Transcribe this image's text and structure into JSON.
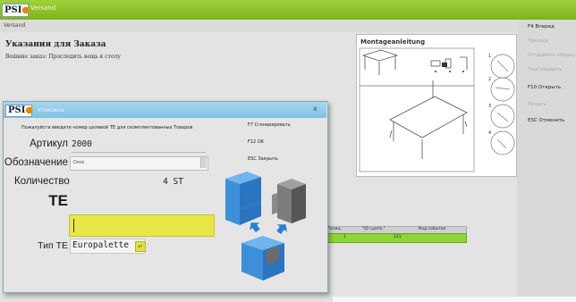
{
  "colors": {
    "accent_green": "#8bc12a",
    "dialog_title_blue": "#8ccbe9",
    "te_input_yellow": "#e9e648",
    "cube_blue": "#3d8fd8",
    "cube_gray": "#7c7c7c"
  },
  "background_window": {
    "logo_text": "PSI",
    "window_title": "Versand",
    "breadcrumb": "Versand",
    "heading": "Указания для Заказа",
    "note": "Вешние заказ: Проследить вещь к столу",
    "side_menu": [
      {
        "label": "F4 Вперед",
        "enabled": true
      },
      {
        "label": "Предыд",
        "enabled": false
      },
      {
        "label": "Отправить сборку",
        "enabled": false
      },
      {
        "label": "Подтвердить",
        "enabled": false
      },
      {
        "label": "F10 Открыть",
        "enabled": true
      },
      {
        "label": "Печать",
        "enabled": false
      },
      {
        "label": "ESC Отменить",
        "enabled": true
      }
    ],
    "instructions_panel": {
      "title": "Montageanleitung",
      "step_numbers": [
        "1",
        "2",
        "3",
        "4"
      ]
    },
    "grid": {
      "headers": [
        "Позиц.",
        "\"ID сцепл.\"",
        "Код события"
      ],
      "row": [
        "1",
        "121",
        ""
      ]
    }
  },
  "dialog": {
    "logo_text": "PSI",
    "window_title": "Упаковка",
    "close_glyph": "x",
    "prompt": "Пожалуйста введите номер целевой ТЕ для скомплектованных Товаров",
    "fields": {
      "article_label": "Артикул",
      "article_value": "2000",
      "description_label": "Обозначение",
      "description_value": "Desk",
      "quantity_label": "Количество",
      "quantity_value": "4 ST",
      "te_label": "TE",
      "te_value": "",
      "te_type_label": "Тип ТЕ",
      "te_type_value": "Europalette",
      "te_type_button": "↵"
    },
    "function_keys": [
      "F7 Сгенерировать",
      "F12 OK",
      "ESC Закрыть"
    ]
  }
}
